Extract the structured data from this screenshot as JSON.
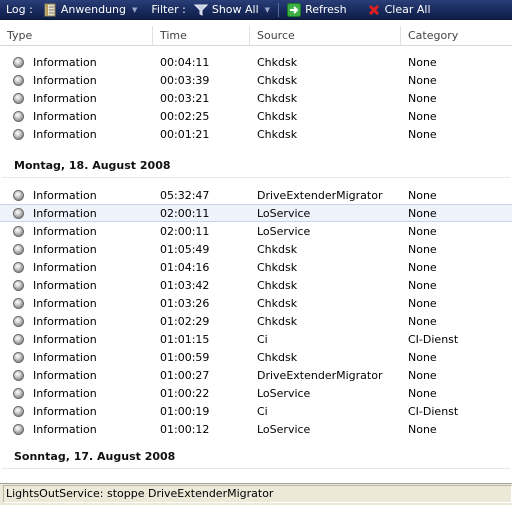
{
  "toolbar": {
    "log_label": "Log :",
    "log_value": "Anwendung",
    "filter_label": "Filter :",
    "filter_value": "Show All",
    "refresh_label": "Refresh",
    "clear_label": "Clear All"
  },
  "columns": [
    "Type",
    "Time",
    "Source",
    "Category"
  ],
  "groups": [
    {
      "header": "",
      "rows": [
        {
          "type": "Information",
          "time": "00:04:11",
          "source": "Chkdsk",
          "category": "None"
        },
        {
          "type": "Information",
          "time": "00:03:39",
          "source": "Chkdsk",
          "category": "None"
        },
        {
          "type": "Information",
          "time": "00:03:21",
          "source": "Chkdsk",
          "category": "None"
        },
        {
          "type": "Information",
          "time": "00:02:25",
          "source": "Chkdsk",
          "category": "None"
        },
        {
          "type": "Information",
          "time": "00:01:21",
          "source": "Chkdsk",
          "category": "None"
        }
      ]
    },
    {
      "header": "Montag, 18. August 2008",
      "rows": [
        {
          "type": "Information",
          "time": "05:32:47",
          "source": "DriveExtenderMigrator",
          "category": "None"
        },
        {
          "type": "Information",
          "time": "02:00:11",
          "source": "LoService",
          "category": "None",
          "selected": true
        },
        {
          "type": "Information",
          "time": "02:00:11",
          "source": "LoService",
          "category": "None"
        },
        {
          "type": "Information",
          "time": "01:05:49",
          "source": "Chkdsk",
          "category": "None"
        },
        {
          "type": "Information",
          "time": "01:04:16",
          "source": "Chkdsk",
          "category": "None"
        },
        {
          "type": "Information",
          "time": "01:03:42",
          "source": "Chkdsk",
          "category": "None"
        },
        {
          "type": "Information",
          "time": "01:03:26",
          "source": "Chkdsk",
          "category": "None"
        },
        {
          "type": "Information",
          "time": "01:02:29",
          "source": "Chkdsk",
          "category": "None"
        },
        {
          "type": "Information",
          "time": "01:01:15",
          "source": "Ci",
          "category": "CI-Dienst"
        },
        {
          "type": "Information",
          "time": "01:00:59",
          "source": "Chkdsk",
          "category": "None"
        },
        {
          "type": "Information",
          "time": "01:00:27",
          "source": "DriveExtenderMigrator",
          "category": "None"
        },
        {
          "type": "Information",
          "time": "01:00:22",
          "source": "LoService",
          "category": "None"
        },
        {
          "type": "Information",
          "time": "01:00:19",
          "source": "Ci",
          "category": "CI-Dienst"
        },
        {
          "type": "Information",
          "time": "01:00:12",
          "source": "LoService",
          "category": "None"
        }
      ]
    },
    {
      "header": "Sonntag, 17. August 2008",
      "rows": []
    }
  ],
  "status": "LightsOutService: stoppe DriveExtenderMigrator",
  "icons": {
    "log": "notebook-icon",
    "filter": "funnel-icon",
    "refresh": "refresh-arrow-icon",
    "clear": "red-x-icon",
    "row": "information-icon"
  }
}
